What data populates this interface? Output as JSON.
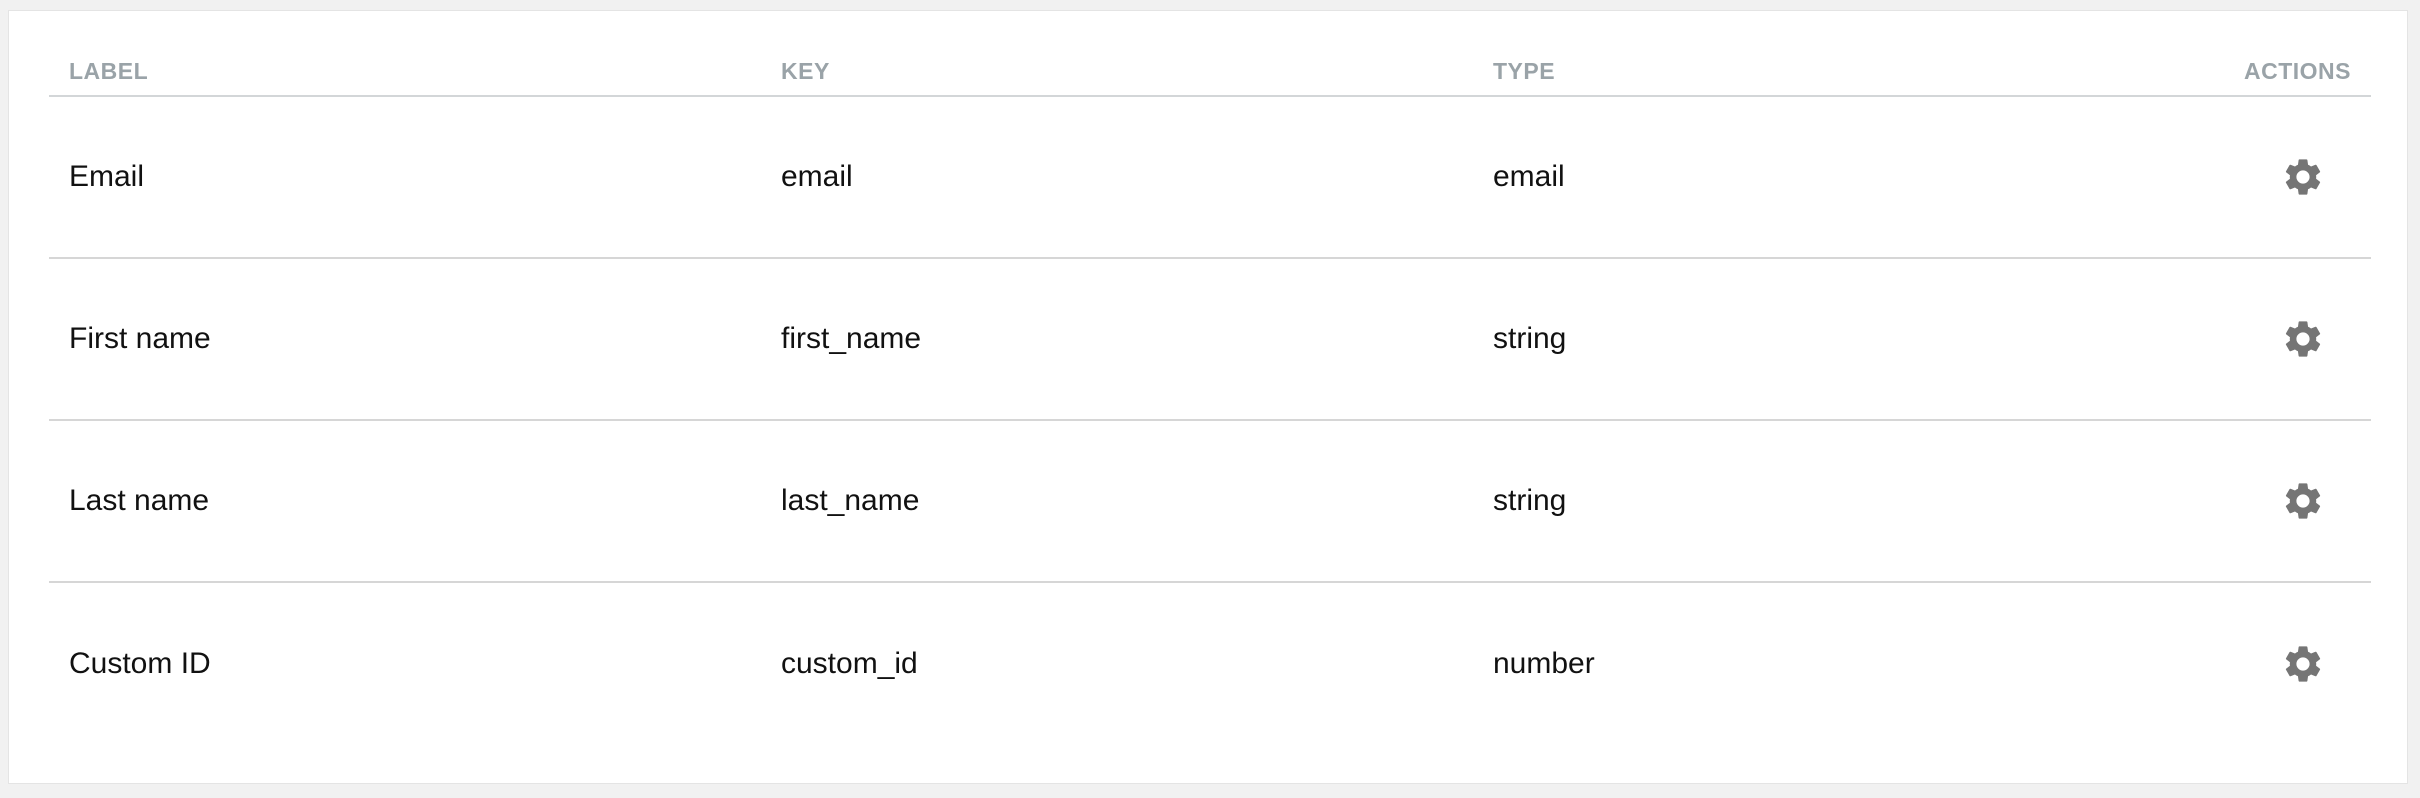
{
  "table": {
    "headers": {
      "label": "LABEL",
      "key": "KEY",
      "type": "TYPE",
      "actions": "ACTIONS"
    },
    "rows": [
      {
        "label": "Email",
        "key": "email",
        "type": "email",
        "action_icon": "gear-icon"
      },
      {
        "label": "First name",
        "key": "first_name",
        "type": "string",
        "action_icon": "gear-icon"
      },
      {
        "label": "Last name",
        "key": "last_name",
        "type": "string",
        "action_icon": "gear-icon"
      },
      {
        "label": "Custom ID",
        "key": "custom_id",
        "type": "number",
        "action_icon": "gear-icon"
      }
    ]
  },
  "colors": {
    "header_text": "#9aa3a8",
    "icon": "#757575",
    "divider": "#d6d6d6",
    "background": "#f1f1f1",
    "card": "#ffffff"
  }
}
